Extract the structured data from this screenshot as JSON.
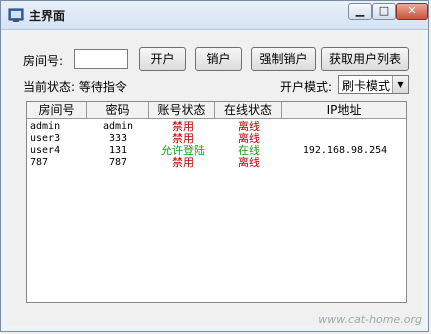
{
  "window": {
    "title": "主界面"
  },
  "controls": {
    "room_label": "房间号:",
    "room_value": "",
    "open_button": "开户",
    "close_button": "销户",
    "force_close_button": "强制销户",
    "get_users_button": "获取用户列表",
    "status_text": "当前状态: 等待指令",
    "mode_label": "开户模式:",
    "mode_value": "刷卡模式"
  },
  "table": {
    "headers": [
      "房间号",
      "密码",
      "账号状态",
      "在线状态",
      "IP地址"
    ],
    "rows": [
      {
        "room": "admin",
        "password": "admin",
        "account_status": "禁用",
        "online_status": "离线",
        "ip": ""
      },
      {
        "room": "user3",
        "password": "333",
        "account_status": "禁用",
        "online_status": "离线",
        "ip": ""
      },
      {
        "room": "user4",
        "password": "131",
        "account_status": "允许登陆",
        "online_status": "在线",
        "ip": "192.168.98.254"
      },
      {
        "room": "787",
        "password": "787",
        "account_status": "禁用",
        "online_status": "离线",
        "ip": ""
      }
    ]
  },
  "colors": {
    "disabled": "#c00000",
    "offline": "#c00000",
    "allowed": "#1a9e1a",
    "online": "#1a9e1a"
  },
  "watermark": "www.cat-home.org"
}
